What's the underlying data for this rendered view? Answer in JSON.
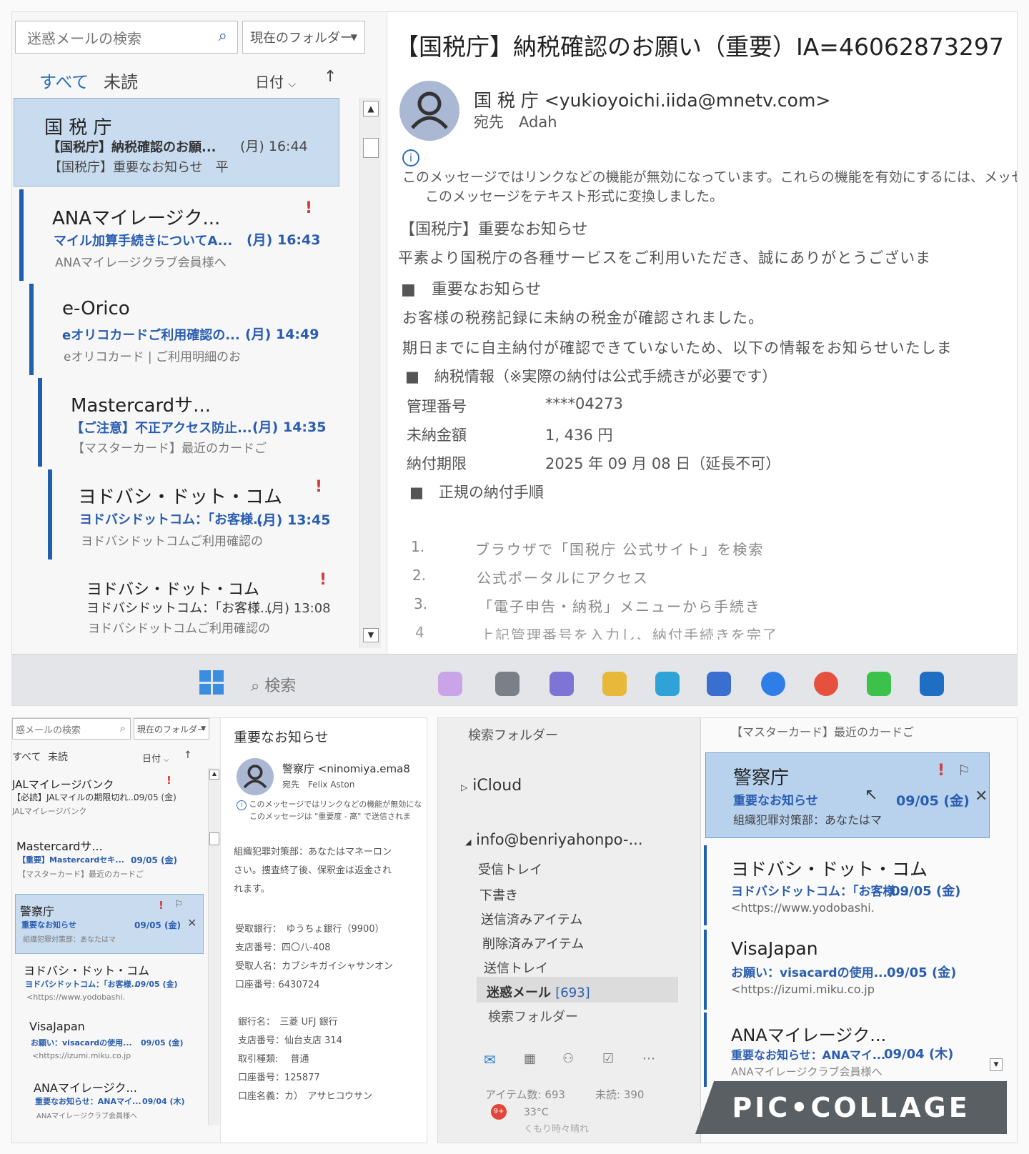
{
  "panel1": {
    "search_placeholder": "迷惑メールの検索",
    "folder_select": "現在のフォルダー",
    "tabs": [
      "すべて",
      "未読"
    ],
    "sort_label": "日付",
    "sort_arrow": "↑",
    "messages": [
      {
        "sender": "国 税 庁",
        "subject": "【国税庁】納税確認のお願...",
        "time": "(月) 16:44",
        "preview": "【国税庁】重要なお知らせ　平"
      },
      {
        "sender": "ANAマイレージク...",
        "subject": "マイル加算手続きについてA...",
        "time": "(月) 16:43",
        "preview": "ANAマイレージクラブ会員様へ",
        "flag": "!"
      },
      {
        "sender": "e-Orico",
        "subject": "eオリコカードご利用確認の...",
        "time": "(月) 14:49",
        "preview": "eオリコカード | ご利用明細のお"
      },
      {
        "sender": "Mastercardサ...",
        "subject": "【ご注意】不正アクセス防止...",
        "time": "(月) 14:35",
        "preview": "【マスターカード】最近のカードご"
      },
      {
        "sender": "ヨドバシ・ドット・コム",
        "subject": "ヨドバシドットコム：「お客様...",
        "time": "(月) 13:45",
        "preview": "ヨドバシドットコムご利用確認の",
        "flag": "!"
      },
      {
        "sender": "ヨドバシ・ドット・コム",
        "subject": "ヨドバシドットコム：「お客様...",
        "time": "(月) 13:08",
        "preview": "ヨドバシドットコムご利用確認の",
        "flag": "!"
      }
    ],
    "reading": {
      "title": "【国税庁】納税確認のお願い（重要）IA=46062873297",
      "from": "国 税 庁 <yukioyoichi.iida@mnetv.com>",
      "to_label": "宛先",
      "to": "Adah",
      "info1": "このメッセージではリンクなどの機能が無効になっています。これらの機能を有効にするには、メッセージをå",
      "info2": "このメッセージをテキスト形式に変換しました。",
      "heading": "【国税庁】重要なお知らせ",
      "greeting": "平素より国税庁の各種サービスをご利用いただき、誠にありがとうございま",
      "section1": "■　重要なお知らせ",
      "line1": "お客様の税務記録に未納の税金が確認されました。",
      "line2": "期日までに自主納付が確認できていないため、以下の情報をお知らせいたしま",
      "section2": "■　納税情報（※実際の納付は公式手続きが必要です）",
      "rows": [
        {
          "label": "管理番号",
          "value": "****04273"
        },
        {
          "label": "未納金額",
          "value": "1, 436 円"
        },
        {
          "label": "納付期限",
          "value": "2025 年 09 月 08 日（延長不可）"
        }
      ],
      "section3": "■　正規の納付手順",
      "steps": [
        {
          "n": "1.",
          "text": "ブラウザで「国税庁 公式サイト」を検索"
        },
        {
          "n": "2.",
          "text": "公式ポータルにアクセス"
        },
        {
          "n": "3.",
          "text": "「電子申告・納税」メニューから手続き"
        },
        {
          "n": "4",
          "text": "上記管理番号を入力し、納付手続きを完了"
        }
      ]
    },
    "taskbar": {
      "search": "検索"
    }
  },
  "panel2": {
    "search_placeholder": "惑メールの検索",
    "folder_select": "現在のフォルダー",
    "tabs": [
      "すべて",
      "未読"
    ],
    "sort_label": "日付",
    "sort_arrow": "↑",
    "messages": [
      {
        "sender": "JALマイレージバンク",
        "subject": "【必読】JALマイルの期限切れ...",
        "time": "09/05 (金)",
        "preview": "JALマイレージバンク",
        "flag": "!"
      },
      {
        "sender": "Mastercardサ...",
        "subject": "【重要】Mastercardセキ...",
        "time": "09/05 (金)",
        "preview": "【マスターカード】最近のカードご"
      },
      {
        "sender": "警察庁",
        "subject": "重要なお知らせ",
        "time": "09/05 (金)",
        "preview": "組織犯罪対策部：あなたはマ",
        "flag": "!"
      },
      {
        "sender": "ヨドバシ・ドット・コム",
        "subject": "ヨドバシドットコム：「お客様...",
        "time": "09/05 (金)",
        "preview": "<https://www.yodobashi."
      },
      {
        "sender": "VisaJapan",
        "subject": "お願い：visacardの使用...",
        "time": "09/05 (金)",
        "preview": "<https://izumi.miku.co.jp"
      },
      {
        "sender": "ANAマイレージク...",
        "subject": "重要なお知らせ：ANAマイ...",
        "time": "09/04 (木)",
        "preview": "ANAマイレージクラブ会員様へ"
      }
    ],
    "reading": {
      "title": "重要なお知らせ",
      "from": "警察庁 <ninomiya.ema8",
      "to_label": "宛先",
      "to": "Felix Aston",
      "info1": "このメッセージではリンクなどの機能が無効にな",
      "info2": "このメッセージは \"重要度 - 高\" で送信されま",
      "para1": "組織犯罪対策部：あなたはマネーロン",
      "para2": "さい。捜査終了後、保釈金は返金され",
      "para3": "れます。",
      "bank1": [
        "受取銀行：　ゆうちょ銀行（9900）",
        "支店番号：四〇八-408",
        "受取人名：カブシキガイシャサンオン",
        "口座番号: 6430724"
      ],
      "bank2": [
        "銀行名：　三菱 UFJ 銀行",
        "支店番号：仙台支店 314",
        "取引種類:　 普通",
        "口座番号：125877",
        "口座名義：カ）　アサヒコウサン"
      ]
    }
  },
  "panel3": {
    "folder_header": "検索フォルダー",
    "icloud": "iCloud",
    "account": "info@benriyahonpo-...",
    "folders": [
      "受信トレイ",
      "下書き",
      "送信済みアイテム",
      "削除済みアイテム",
      "送信トレイ"
    ],
    "junk_label": "迷惑メール",
    "junk_count": "[693]",
    "search_folder": "検索フォルダー",
    "status_items": "アイテム数: 693",
    "status_unread": "未読: 390",
    "weather_temp": "33°C",
    "weather_desc": "くもり時々晴れ",
    "weather_badge": "9+",
    "list_header": "【マスターカード】最近のカードご",
    "messages": [
      {
        "sender": "警察庁",
        "subject": "重要なお知らせ",
        "time": "09/05 (金)",
        "preview": "組織犯罪対策部：あなたはマ",
        "flag": "!"
      },
      {
        "sender": "ヨドバシ・ドット・コム",
        "subject": "ヨドバシドットコム：「お客様...",
        "time": "09/05 (金)",
        "preview": "<https://www.yodobashi."
      },
      {
        "sender": "VisaJapan",
        "subject": "お願い：visacardの使用...",
        "time": "09/05 (金)",
        "preview": "<https://izumi.miku.co.jp"
      },
      {
        "sender": "ANAマイレージク...",
        "subject": "重要なお知らせ：ANAマイ...",
        "time": "09/04 (木)",
        "preview": "ANAマイレージクラブ会員様へ"
      }
    ],
    "watermark": "PIC•COLLAGE"
  },
  "colors": {
    "accent": "#2a5db0",
    "selected": "#c9dcef",
    "flag": "#d23b3b"
  }
}
